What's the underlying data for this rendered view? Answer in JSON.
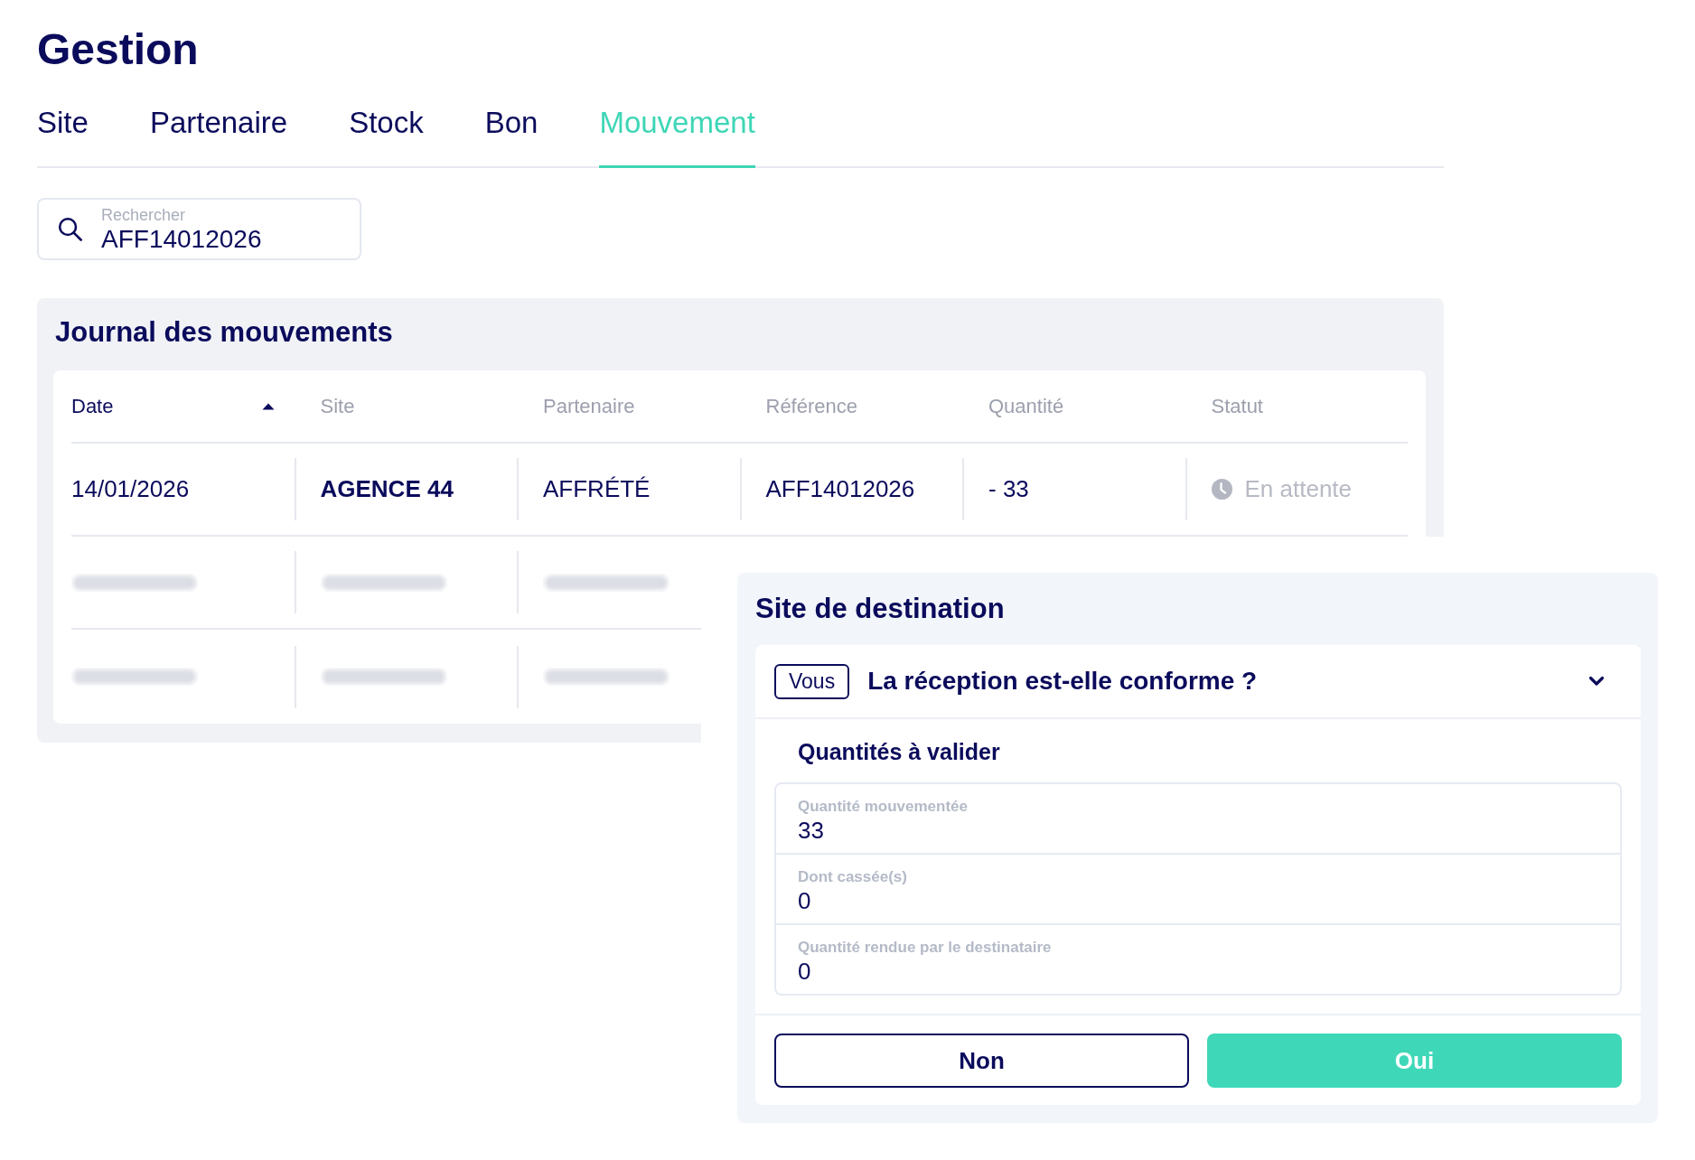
{
  "page_title": "Gestion",
  "tabs": [
    {
      "label": "Site",
      "selected": false
    },
    {
      "label": "Partenaire",
      "selected": false
    },
    {
      "label": "Stock",
      "selected": false
    },
    {
      "label": "Bon",
      "selected": false
    },
    {
      "label": "Mouvement",
      "selected": true
    }
  ],
  "search": {
    "label": "Rechercher",
    "value": "AFF14012026"
  },
  "journal": {
    "title": "Journal des mouvements",
    "columns": [
      {
        "label": "Date",
        "sorted": true
      },
      {
        "label": "Site",
        "sorted": false
      },
      {
        "label": "Partenaire",
        "sorted": false
      },
      {
        "label": "Référence",
        "sorted": false
      },
      {
        "label": "Quantité",
        "sorted": false
      },
      {
        "label": "Statut",
        "sorted": false
      }
    ],
    "rows": [
      {
        "kind": "entry",
        "date": "14/01/2026",
        "site": "AGENCE 44",
        "partner": "AFFRÉTÉ",
        "reference": "AFF14012026",
        "quantity": "- 33",
        "status": {
          "label": "En attente",
          "kind": "pending"
        }
      },
      {
        "kind": "blurred"
      },
      {
        "kind": "blurred"
      }
    ]
  },
  "destination_panel": {
    "title": "Site de destination",
    "step": {
      "badge": "Vous",
      "question": "La réception est-elle conforme ?",
      "expanded": true,
      "section_title": "Quantités à valider",
      "fields": [
        {
          "label": "Quantité mouvementée",
          "value": "33"
        },
        {
          "label": "Dont cassée(s)",
          "value": "0"
        },
        {
          "label": "Quantité rendue par le destinataire",
          "value": "0"
        }
      ],
      "buttons": [
        {
          "label": "Non",
          "kind": "secondary"
        },
        {
          "label": "Oui",
          "kind": "primary"
        }
      ]
    }
  }
}
